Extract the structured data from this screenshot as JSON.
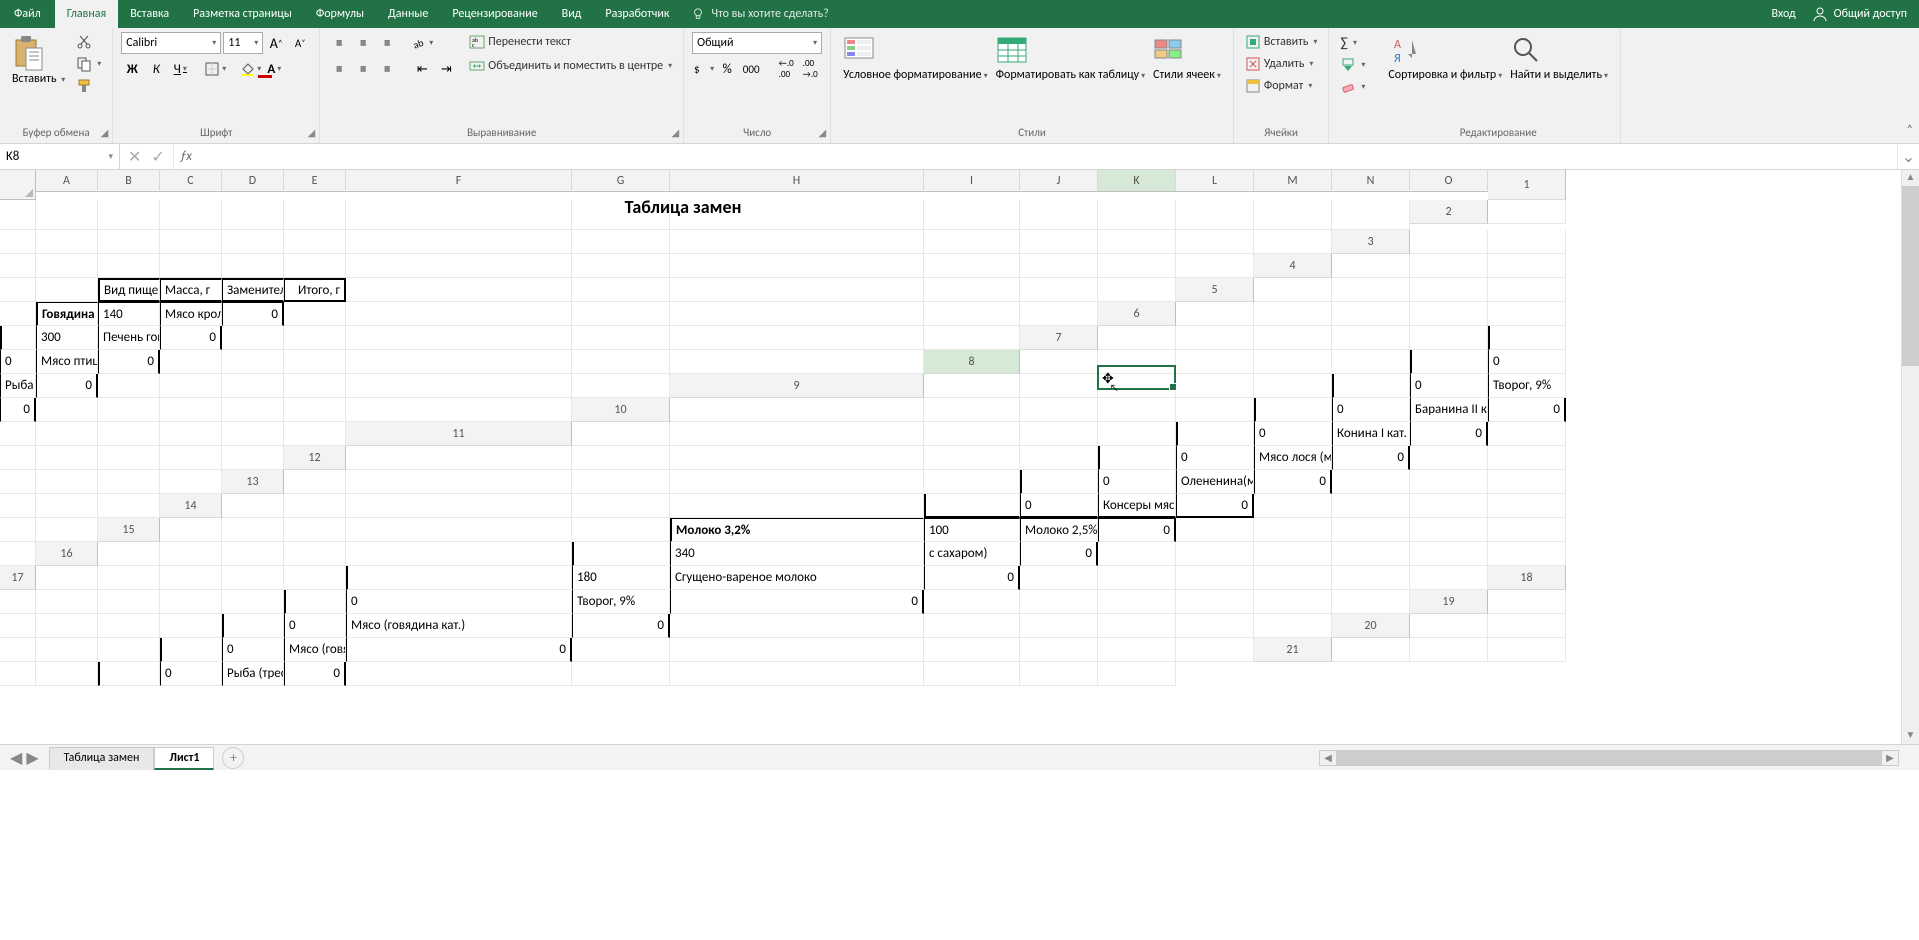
{
  "menu": {
    "file": "Файл",
    "tabs": [
      "Главная",
      "Вставка",
      "Разметка страницы",
      "Формулы",
      "Данные",
      "Рецензирование",
      "Вид",
      "Разработчик"
    ],
    "active": 0,
    "tell_me": "Что вы хотите сделать?",
    "login": "Вход",
    "share": "Общий доступ"
  },
  "ribbon": {
    "clipboard": {
      "paste": "Вставить",
      "label": "Буфер обмена"
    },
    "font": {
      "name": "Calibri",
      "size": "11",
      "label": "Шрифт",
      "bold": "Ж",
      "italic": "К",
      "underline": "Ч"
    },
    "align": {
      "wrap": "Перенести текст",
      "merge": "Объединить и поместить в центре",
      "label": "Выравнивание"
    },
    "number": {
      "format": "Общий",
      "label": "Число"
    },
    "styles": {
      "cond": "Условное форматирование",
      "table": "Форматировать как таблицу",
      "cell": "Стили ячеек",
      "label": "Стили"
    },
    "cells": {
      "insert": "Вставить",
      "delete": "Удалить",
      "format": "Формат",
      "label": "Ячейки"
    },
    "editing": {
      "sort": "Сортировка и фильтр",
      "find": "Найти и выделить",
      "label": "Редактирование"
    }
  },
  "namebox": "K8",
  "formula": "",
  "columns": [
    "A",
    "B",
    "C",
    "D",
    "E",
    "F",
    "G",
    "H",
    "I",
    "J",
    "K",
    "L",
    "M",
    "N",
    "O"
  ],
  "active_col": "K",
  "active_row": 8,
  "title": "Таблица замен",
  "headers": {
    "product": "Вид пищевого продукта",
    "mass": "Масса, г",
    "subst": "Заменитель",
    "total": "Итого, г"
  },
  "rows": [
    {
      "product": "Говядина",
      "bold": true,
      "mass": "140",
      "subst": "Мясо кролика",
      "total": "0"
    },
    {
      "product": "",
      "mass": "300",
      "subst": "Печень говяжья",
      "total": "0"
    },
    {
      "product": "",
      "mass": "0",
      "subst": "Мясо птицы",
      "total": "0"
    },
    {
      "product": "",
      "mass": "0",
      "subst": "Рыба (треска)",
      "total": "0"
    },
    {
      "product": "",
      "mass": "0",
      "subst": "Творог, 9%",
      "total": "0"
    },
    {
      "product": "",
      "mass": "0",
      "subst": "Баранина II кат.",
      "total": "0"
    },
    {
      "product": "",
      "mass": "0",
      "subst": "Конина I кат.",
      "total": "0"
    },
    {
      "product": "",
      "mass": "0",
      "subst": "Мясо лося (мясо с ферм)",
      "total": "0"
    },
    {
      "product": "",
      "mass": "0",
      "subst": "Олененина(мясо с ферм)",
      "total": "0"
    },
    {
      "product": "",
      "mass": "0",
      "subst": "Консеры мясные",
      "total": "0",
      "sectionend": true
    },
    {
      "product": "Молоко 3,2%",
      "bold": true,
      "mass": "100",
      "subst": "Молоко 2,5%",
      "total": "0"
    },
    {
      "product": "",
      "mass": "340",
      "subst": "с сахаром)",
      "total": "0"
    },
    {
      "product": "",
      "mass": "180",
      "subst": "Сгущено-вареное молоко",
      "total": "0"
    },
    {
      "product": "",
      "mass": "0",
      "subst": "Творог, 9%",
      "total": "0"
    },
    {
      "product": "",
      "mass": "0",
      "subst": "Мясо (говядина кат.)",
      "total": "0"
    },
    {
      "product": "",
      "mass": "0",
      "subst": "Мясо (говядина кат.)",
      "total": "0"
    },
    {
      "product": "",
      "mass": "0",
      "subst": "Рыба (треска)",
      "total": "0"
    }
  ],
  "sheets": {
    "tabs": [
      "Таблица замен",
      "Лист1"
    ],
    "active": 1
  }
}
